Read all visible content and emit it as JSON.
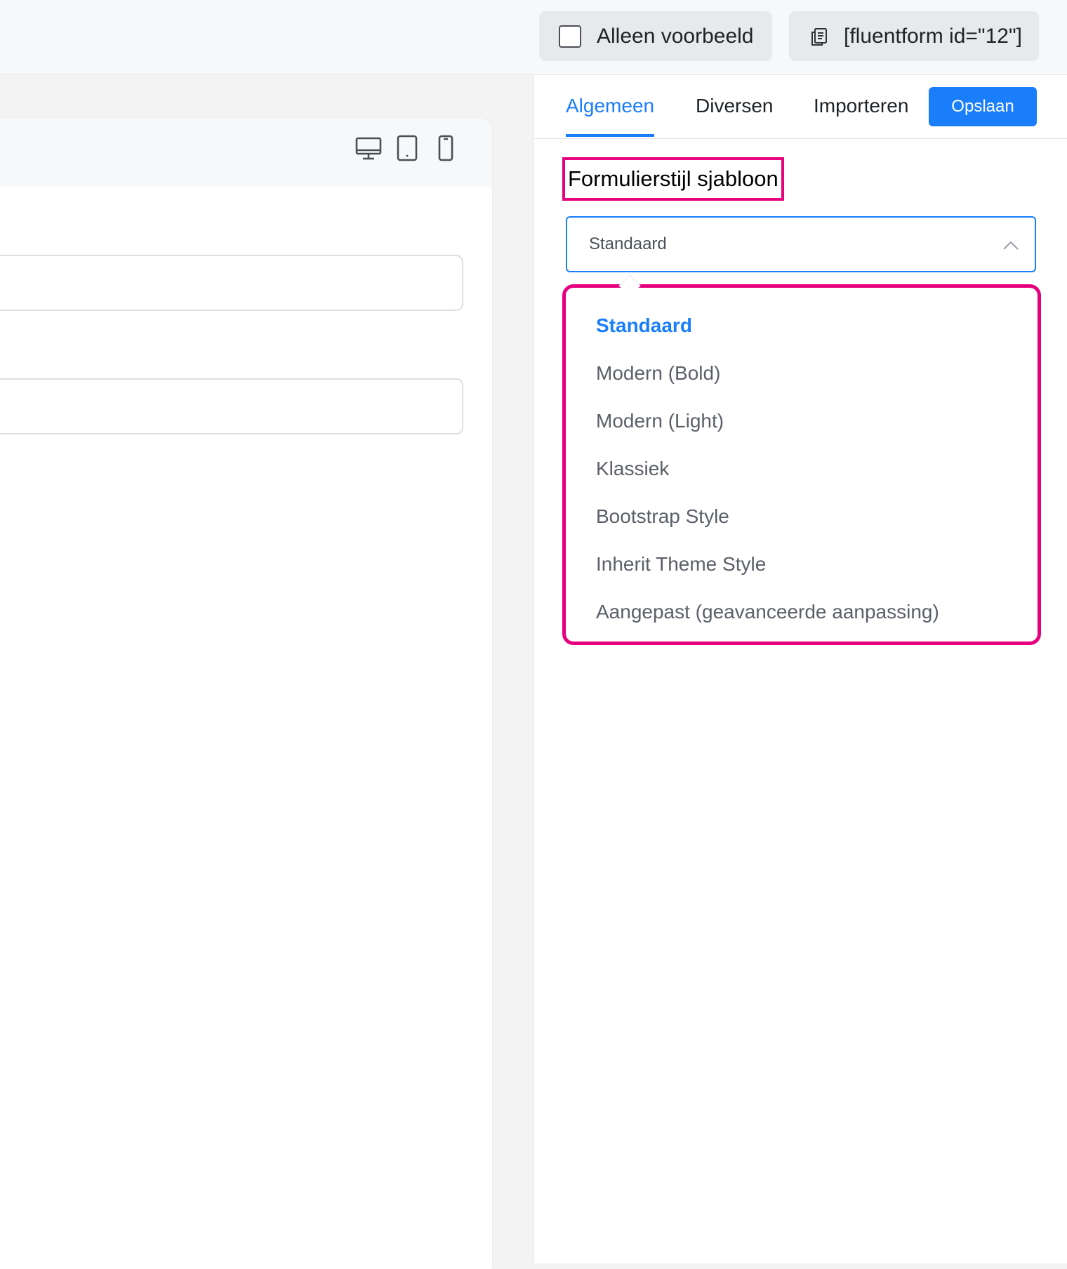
{
  "topbar": {
    "preview_only_label": "Alleen voorbeeld",
    "shortcode_label": "[fluentform id=\"12\"]"
  },
  "canvas": {
    "device_icons": [
      "desktop-icon",
      "tablet-icon",
      "mobile-icon"
    ]
  },
  "panel": {
    "tabs": [
      {
        "label": "Algemeen",
        "active": true
      },
      {
        "label": "Diversen",
        "active": false
      },
      {
        "label": "Importeren",
        "active": false
      }
    ],
    "save_label": "Opslaan",
    "section_label": "Formulierstijl sjabloon",
    "select_value": "Standaard",
    "options": [
      {
        "label": "Standaard",
        "selected": true
      },
      {
        "label": "Modern (Bold)",
        "selected": false
      },
      {
        "label": "Modern (Light)",
        "selected": false
      },
      {
        "label": "Klassiek",
        "selected": false
      },
      {
        "label": "Bootstrap Style",
        "selected": false
      },
      {
        "label": "Inherit Theme Style",
        "selected": false
      },
      {
        "label": "Aangepast (geavanceerde aanpassing)",
        "selected": false
      }
    ]
  },
  "colors": {
    "accent": "#1a7efb",
    "highlight": "#e6007e"
  }
}
